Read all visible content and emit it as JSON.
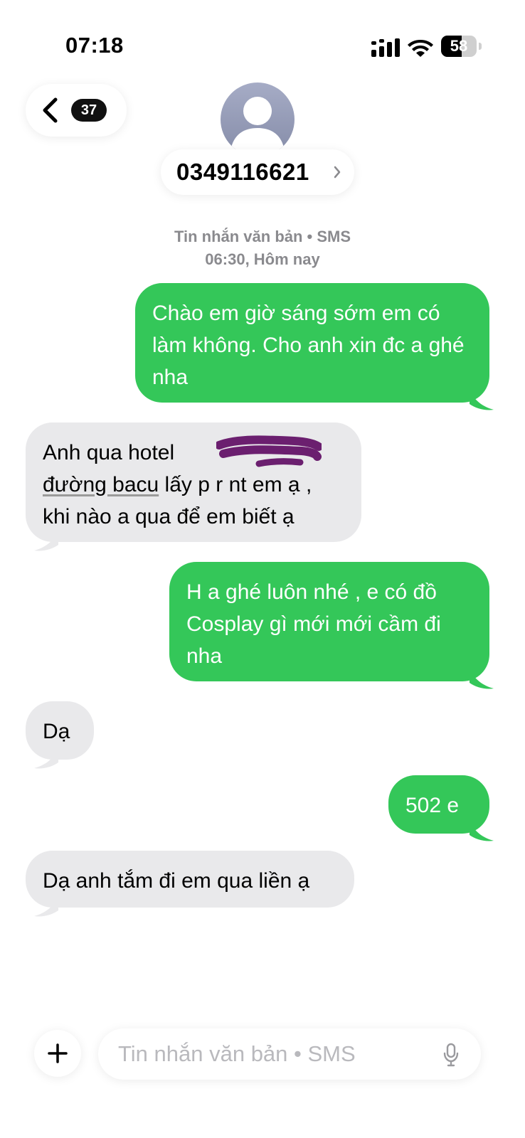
{
  "status_bar": {
    "time": "07:18",
    "battery_percent": "58",
    "battery_level": 0.58
  },
  "header": {
    "unread_count": "37",
    "contact": "0349116621",
    "contact_chevron": "›"
  },
  "meta": {
    "service": "Tin nhắn văn bản • SMS",
    "timestamp": "06:30, Hôm nay"
  },
  "messages": [
    {
      "direction": "outgoing",
      "text": "Chào em giờ sáng sớm em có làm không. Cho anh xin đc a ghé nha"
    },
    {
      "direction": "incoming",
      "lines": [
        "Anh qua hotel",
        "đường bacu",
        " lấy p r nt em ạ ,",
        "khi nào a qua để em biết ạ"
      ]
    },
    {
      "direction": "outgoing",
      "text": "H a ghé luôn nhé , e có đồ Cosplay gì mới mới cầm đi nha"
    },
    {
      "direction": "incoming",
      "text": "Dạ"
    },
    {
      "direction": "outgoing",
      "text": "502 e"
    },
    {
      "direction": "incoming",
      "text": "Dạ anh tắm đi em qua liền ạ"
    }
  ],
  "input": {
    "placeholder": "Tin nhắn văn bản • SMS"
  },
  "icons": {
    "back": "chevron-left-icon",
    "avatar": "person-silhouette-icon",
    "signal": "cellular-signal-icon",
    "wifi": "wifi-icon",
    "battery": "battery-icon",
    "plus": "plus-icon",
    "mic": "microphone-icon"
  },
  "colors": {
    "outgoing_bubble": "#34c759",
    "incoming_bubble": "#e9e9eb",
    "meta_text": "#8a8a8e",
    "placeholder_text": "#b9b9bd"
  }
}
